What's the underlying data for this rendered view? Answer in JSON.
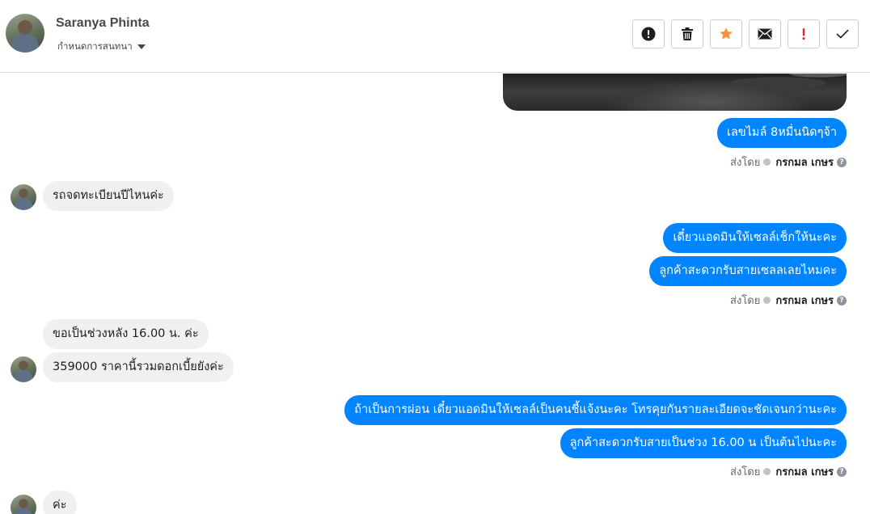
{
  "header": {
    "user_name": "Saranya Phinta",
    "assign_label": "กำหนดการสนทนา",
    "actions": [
      {
        "name": "mark-spam-button",
        "icon": "alert-circle-icon"
      },
      {
        "name": "delete-button",
        "icon": "trash-icon"
      },
      {
        "name": "star-button",
        "icon": "star-icon"
      },
      {
        "name": "mark-unread-button",
        "icon": "envelope-icon"
      },
      {
        "name": "follow-up-button",
        "icon": "exclamation-icon"
      },
      {
        "name": "mark-done-button",
        "icon": "check-icon"
      }
    ]
  },
  "colors": {
    "outgoing_bubble": "#0084ff",
    "incoming_bubble": "#f0f0f0",
    "star": "#f7923b",
    "exclamation": "#e4262c"
  },
  "messages": [
    {
      "direction": "out",
      "type": "image",
      "icon": "photo-icon"
    },
    {
      "direction": "out",
      "text": "เลขไมล์ 8หมื่นนิดๆจ้า"
    },
    {
      "direction": "in",
      "text": "รถจดทะเบียนปีไหนค่ะ"
    },
    {
      "direction": "out",
      "text": "เดี๋ยวแอดมินให้เซลล์เช็กให้นะคะ"
    },
    {
      "direction": "out",
      "text": "ลูกค้าสะดวกรับสายเซลลเลยไหมคะ"
    },
    {
      "direction": "in",
      "text": "ขอเป็นช่วงหลัง 16.00 น. ค่ะ"
    },
    {
      "direction": "in",
      "text": "359000 ราคานี้รวมดอกเบี้ยยังค่ะ"
    },
    {
      "direction": "out",
      "text": "ถ้าเป็นการผ่อน เดี๋ยวแอดมินให้เซลล์เป็นคนชี้แจ้งนะคะ  โทรคุยกันรายละเอียดจะชัดเจนกว่านะคะ"
    },
    {
      "direction": "out",
      "text": "ลูกค้าสะดวกรับสายเป็นช่วง 16.00 น เป็นต้นไปนะคะ"
    },
    {
      "direction": "in",
      "text": "ค่ะ"
    }
  ],
  "sent_by": {
    "prefix": "ส่งโดย",
    "agent": "กรกมล เกษร",
    "help": "?"
  }
}
